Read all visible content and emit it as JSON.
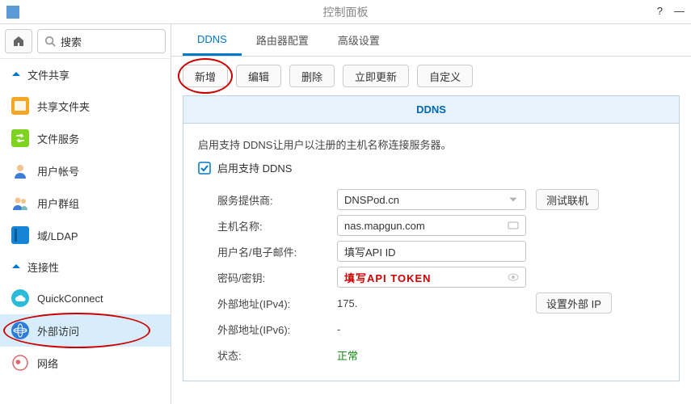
{
  "window": {
    "title": "控制面板"
  },
  "search": {
    "placeholder": "搜索"
  },
  "categories": {
    "fileshare": "文件共享",
    "connectivity": "连接性"
  },
  "sidebar": {
    "items": [
      {
        "label": "共享文件夹"
      },
      {
        "label": "文件服务"
      },
      {
        "label": "用户帐号"
      },
      {
        "label": "用户群组"
      },
      {
        "label": "域/LDAP"
      },
      {
        "label": "QuickConnect"
      },
      {
        "label": "外部访问"
      },
      {
        "label": "网络"
      }
    ]
  },
  "tabs": [
    {
      "label": "DDNS"
    },
    {
      "label": "路由器配置"
    },
    {
      "label": "高级设置"
    }
  ],
  "toolbar": {
    "add": "新增",
    "edit": "编辑",
    "delete": "删除",
    "update": "立即更新",
    "custom": "自定义"
  },
  "panel": {
    "title": "DDNS",
    "desc": "启用支持 DDNS让用户以注册的主机名称连接服务器。",
    "enable_label": "启用支持 DDNS",
    "provider_label": "服务提供商:",
    "provider_value": "DNSPod.cn",
    "test_btn": "测试联机",
    "host_label": "主机名称:",
    "host_value": "nas.mapgun.com",
    "user_label": "用户名/电子邮件:",
    "user_value": "填写API ID",
    "pass_label": "密码/密钥:",
    "pass_value": "填写API TOKEN",
    "ipv4_label": "外部地址(IPv4):",
    "ipv4_value": "175.",
    "ipv4_btn": "设置外部 IP",
    "ipv6_label": "外部地址(IPv6):",
    "ipv6_value": "-",
    "status_label": "状态:",
    "status_value": "正常"
  }
}
